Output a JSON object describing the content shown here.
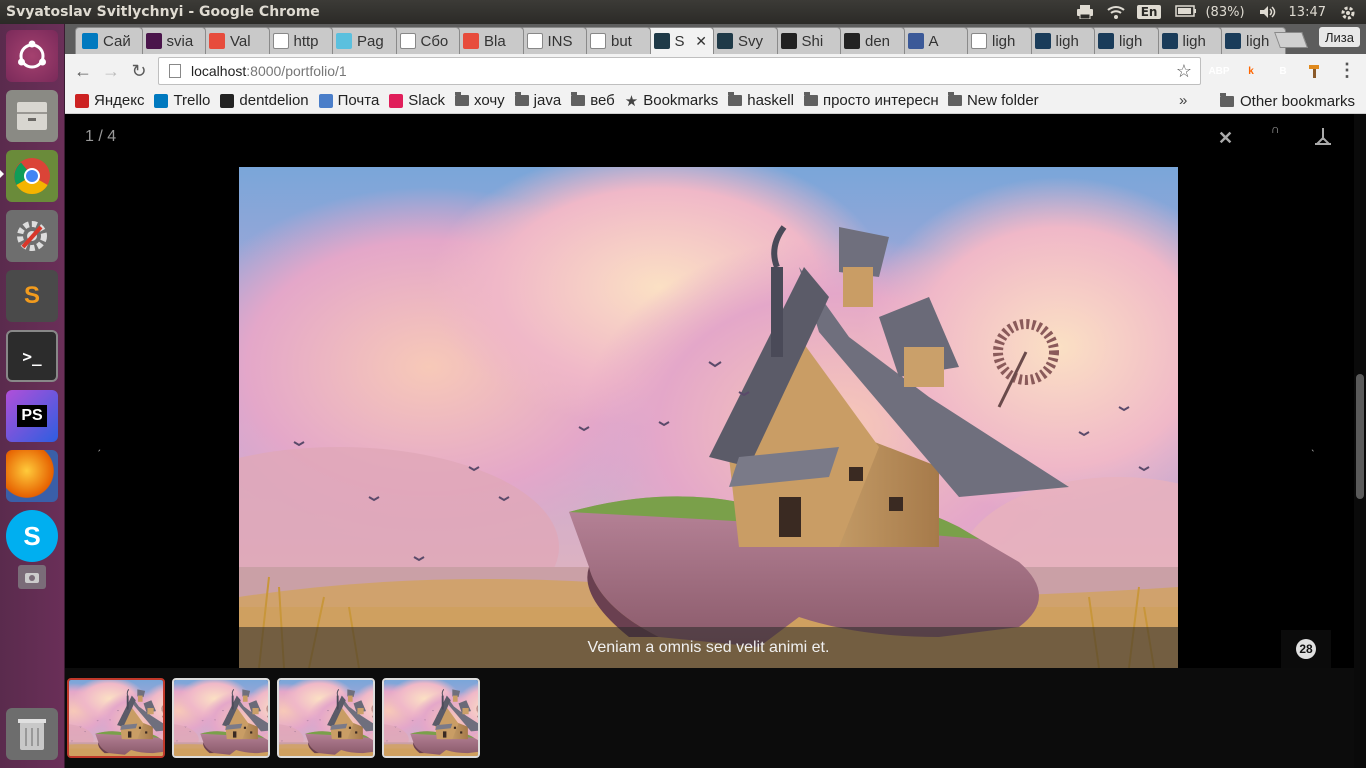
{
  "system": {
    "window_title": "Svyatoslav Svitlychnyi - Google Chrome",
    "keyboard_layout": "En",
    "battery": "(83%)",
    "clock": "13:47"
  },
  "launcher": {
    "items": [
      "ubuntu-dash",
      "files",
      "chrome",
      "system-settings",
      "sublime-text",
      "terminal",
      "phpstorm",
      "firefox",
      "skype",
      "screenshot",
      "trash"
    ]
  },
  "tabs": [
    {
      "label": "Сай",
      "icon": "trello-icon",
      "color": "#0079bf"
    },
    {
      "label": "svia",
      "icon": "slack-hash-icon",
      "color": "#4a154b"
    },
    {
      "label": "Val",
      "icon": "redmine-icon",
      "color": "#e74c3c"
    },
    {
      "label": "http",
      "icon": "page-icon",
      "color": "#ffffff"
    },
    {
      "label": "Pag",
      "icon": "feather-icon",
      "color": "#5bc0de"
    },
    {
      "label": "Сбо",
      "icon": "tb-icon",
      "color": "#ffffff"
    },
    {
      "label": "Bla",
      "icon": "redmine-icon",
      "color": "#e74c3c"
    },
    {
      "label": "INS",
      "icon": "page-icon",
      "color": "#ffffff"
    },
    {
      "label": "but",
      "icon": "page-icon",
      "color": "#ffffff"
    },
    {
      "label": "S",
      "icon": "k-icon",
      "color": "#1f3a48",
      "active": true
    },
    {
      "label": "Svy",
      "icon": "k-icon",
      "color": "#1f3a48"
    },
    {
      "label": "Shi",
      "icon": "github-icon",
      "color": "#222222"
    },
    {
      "label": "den",
      "icon": "github-icon",
      "color": "#222222"
    },
    {
      "label": "A",
      "icon": "play-icon",
      "color": "#3b5998"
    },
    {
      "label": "ligh",
      "icon": "page-icon",
      "color": "#ffffff"
    },
    {
      "label": "ligh",
      "icon": "lg-icon",
      "color": "#1a3c5a"
    },
    {
      "label": "ligh",
      "icon": "lg-icon",
      "color": "#1a3c5a"
    },
    {
      "label": "ligh",
      "icon": "lg-icon",
      "color": "#1a3c5a"
    },
    {
      "label": "ligh",
      "icon": "lg-icon",
      "color": "#1a3c5a"
    }
  ],
  "profile_name": "Лиза",
  "address": {
    "host": "localhost",
    "path": ":8000/portfolio/1"
  },
  "extensions": [
    {
      "label": "ABP",
      "color": "#c0261c"
    },
    {
      "label": "k",
      "color": "#2a2a2a"
    },
    {
      "label": "B",
      "color": "#563d7c"
    },
    {
      "label": "",
      "color": "#e08a1e"
    }
  ],
  "bookmarks": [
    {
      "label": "Яндекс",
      "icon": "yandex-icon",
      "color": "#cc2222"
    },
    {
      "label": "Trello",
      "icon": "trello-icon",
      "color": "#0079bf"
    },
    {
      "label": "dentdelion",
      "icon": "github-icon",
      "color": "#222222"
    },
    {
      "label": "Почта",
      "icon": "mail-icon",
      "color": "#4a7ec9"
    },
    {
      "label": "Slack",
      "icon": "slack-icon",
      "color": "#e01e5a"
    },
    {
      "label": "хочу",
      "icon": "folder-icon"
    },
    {
      "label": "java",
      "icon": "folder-icon"
    },
    {
      "label": "веб",
      "icon": "folder-icon"
    },
    {
      "label": "Bookmarks",
      "icon": "star-icon"
    },
    {
      "label": "haskell",
      "icon": "folder-icon"
    },
    {
      "label": "просто интересн",
      "icon": "folder-icon"
    },
    {
      "label": "New folder",
      "icon": "folder-icon"
    }
  ],
  "bookmarks_overflow": "»",
  "other_bookmarks": "Other bookmarks",
  "lightbox": {
    "counter": "1 / 4",
    "caption": "Veniam a omnis sed velit animi et.",
    "badge": "28",
    "close_glyph": "✕",
    "thumbnail_count": 4,
    "active_thumbnail": 0
  }
}
